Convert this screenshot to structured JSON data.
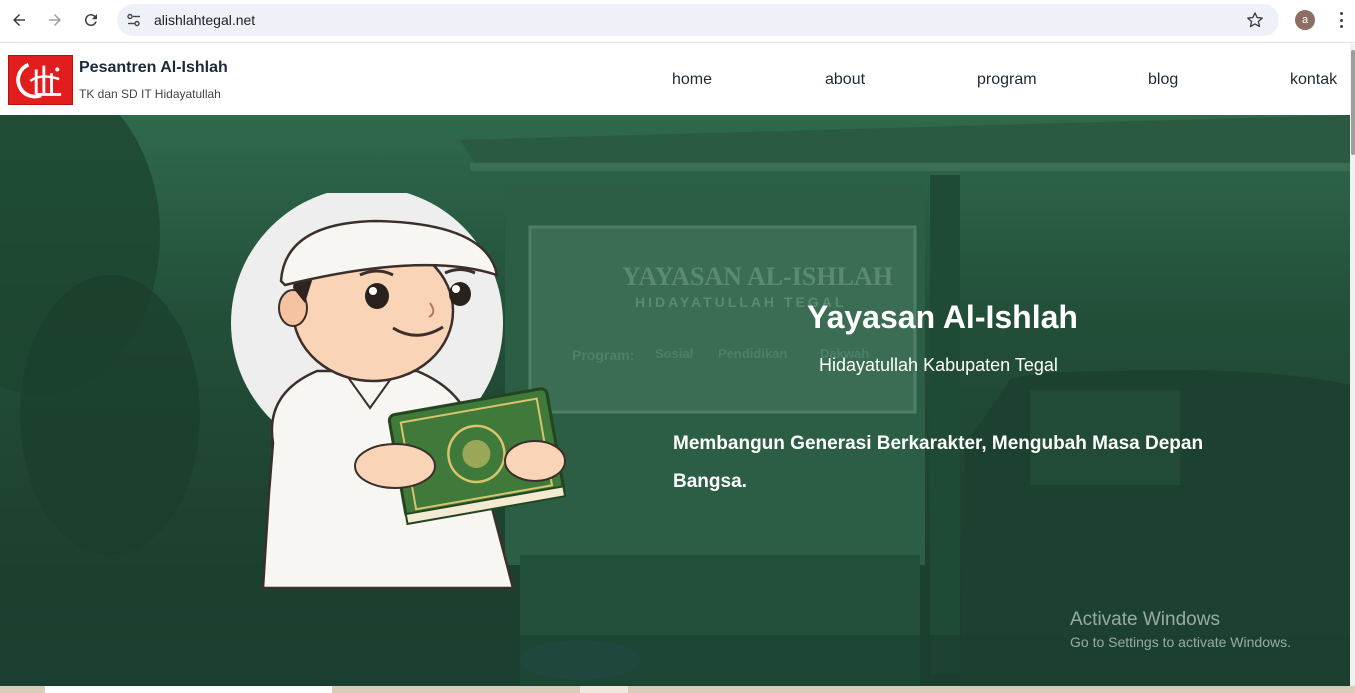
{
  "browser": {
    "url": "alishlahtegal.net",
    "profile_initial": "a"
  },
  "site": {
    "brand_title": "Pesantren Al-Ishlah",
    "brand_subtitle": "TK dan SD IT Hidayatullah",
    "nav": [
      {
        "label": "home"
      },
      {
        "label": "about"
      },
      {
        "label": "program"
      },
      {
        "label": "blog"
      },
      {
        "label": "kontak"
      }
    ]
  },
  "hero": {
    "title": "Yayasan Al-Ishlah",
    "subtitle": "Hidayatullah Kabupaten Tegal",
    "tagline": "Membangun Generasi Berkarakter, Mengubah Masa Depan Bangsa.",
    "background_sign": {
      "line1": "YAYASAN AL-ISHLAH",
      "line2": "HIDAYATULLAH TEGAL",
      "program_label": "Program:",
      "programs": [
        "Sosial",
        "Pendidikan",
        "Dakwah"
      ]
    }
  },
  "watermark": {
    "title": "Activate Windows",
    "subtitle": "Go to Settings to activate Windows."
  },
  "colors": {
    "hero_green": "#234f39",
    "logo_red": "#e21d1d",
    "quran_green": "#3f7a3a"
  },
  "icons": [
    "back-arrow-icon",
    "forward-arrow-icon",
    "reload-icon",
    "site-info-icon",
    "bookmark-star-icon",
    "kebab-menu-icon"
  ]
}
